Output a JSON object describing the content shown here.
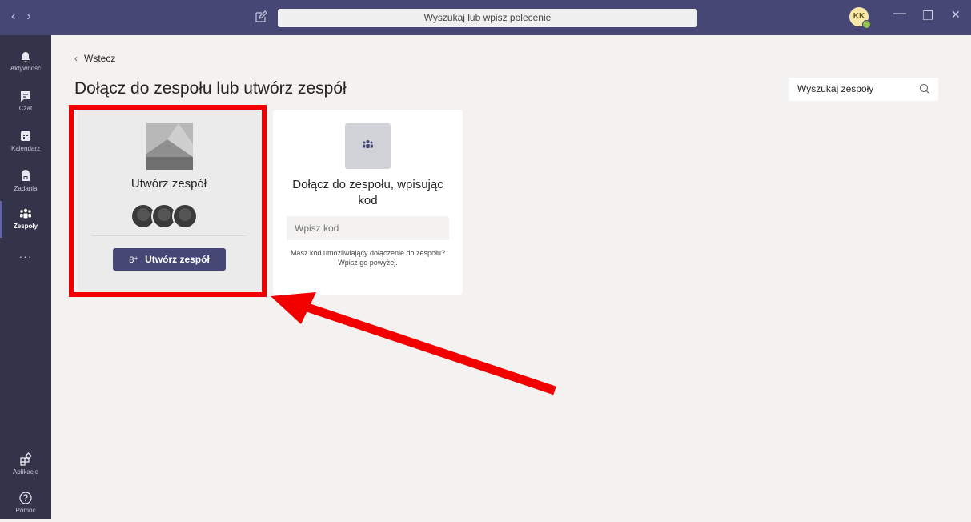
{
  "titlebar": {
    "back_glyph": "‹",
    "forward_glyph": "›",
    "search_placeholder": "Wyszukaj lub wpisz polecenie",
    "avatar_initials": "KK",
    "minimize_glyph": "—",
    "restore_glyph": "❐",
    "close_glyph": "✕",
    "accent_color": "#464775"
  },
  "rail": {
    "items": [
      {
        "label": "Aktywność",
        "icon": "bell-icon"
      },
      {
        "label": "Czat",
        "icon": "chat-icon"
      },
      {
        "label": "Kalendarz",
        "icon": "calendar-icon"
      },
      {
        "label": "Zadania",
        "icon": "assignments-icon"
      },
      {
        "label": "Zespoły",
        "icon": "teams-icon",
        "active": true
      }
    ],
    "more": "···",
    "bottom": [
      {
        "label": "Aplikacje",
        "icon": "apps-icon"
      },
      {
        "label": "Pomoc",
        "icon": "help-icon"
      }
    ]
  },
  "main": {
    "back_label": "Wstecz",
    "title": "Dołącz do zespołu lub utwórz zespół",
    "team_search_placeholder": "Wyszukaj zespoły",
    "create_card": {
      "title": "Utwórz zespół",
      "button_label": "Utwórz zespół"
    },
    "join_card": {
      "title": "Dołącz do zespołu, wpisując kod",
      "input_placeholder": "Wpisz kod",
      "help_text": "Masz kod umożliwiający dołączenie do zespołu? Wpisz go powyżej."
    }
  },
  "annotation": {
    "highlight_color": "#f20000"
  }
}
